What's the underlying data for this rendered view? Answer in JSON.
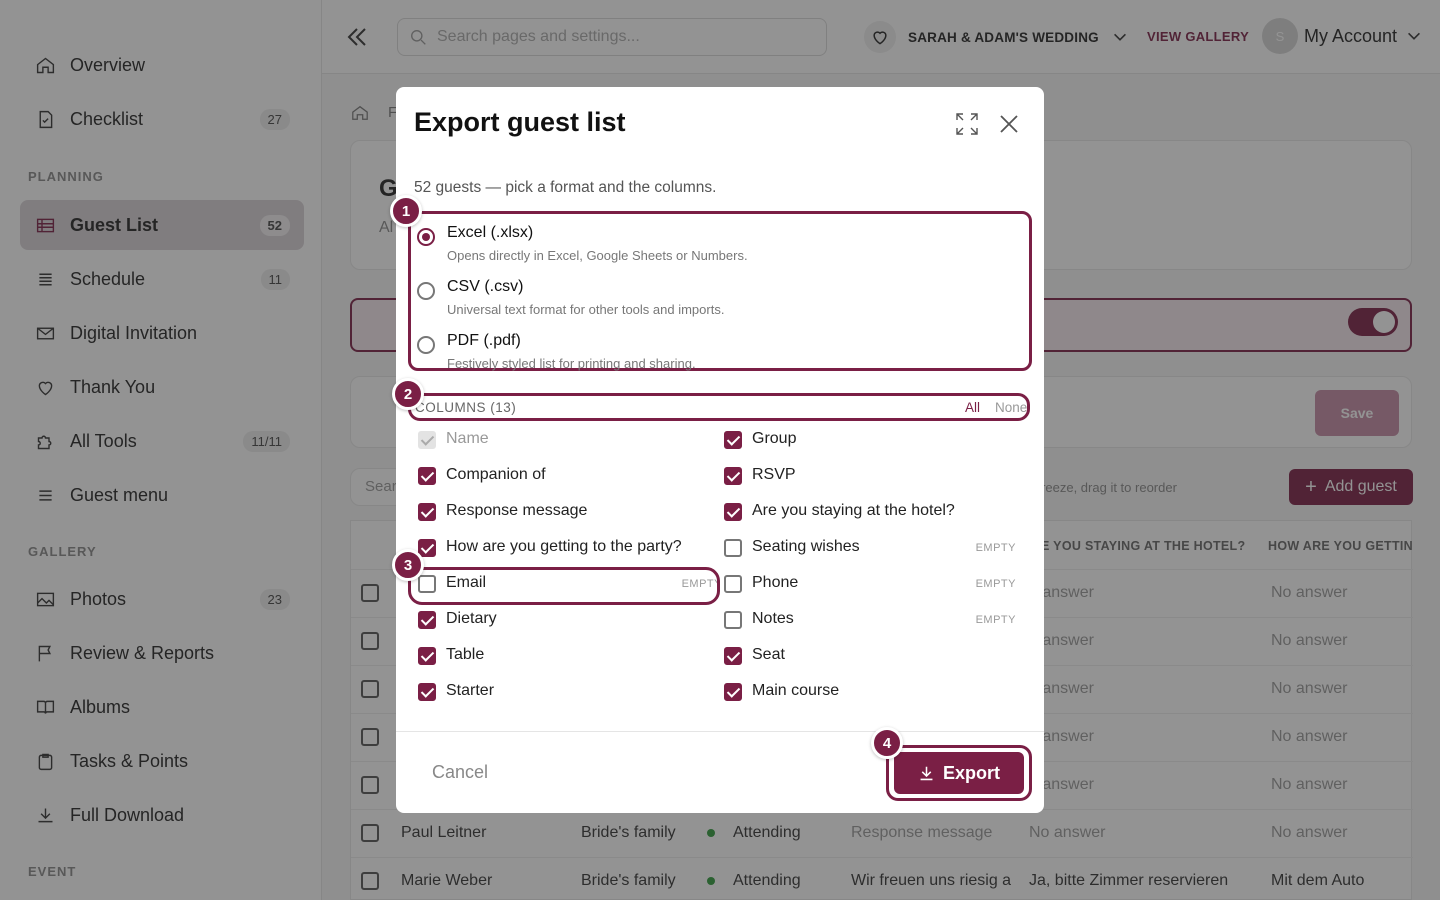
{
  "sidebar": {
    "items": [
      {
        "label": "Overview",
        "icon": "home-icon",
        "badge": ""
      },
      {
        "label": "Checklist",
        "icon": "checklist-icon",
        "badge": "27"
      },
      {
        "label": "Guest List",
        "icon": "table-icon",
        "badge": "52"
      },
      {
        "label": "Schedule",
        "icon": "list-icon",
        "badge": "11"
      },
      {
        "label": "Digital Invitation",
        "icon": "mail-icon",
        "badge": ""
      },
      {
        "label": "Thank You",
        "icon": "heart-icon",
        "badge": ""
      },
      {
        "label": "All Tools",
        "icon": "puzzle-icon",
        "badge": "11/11"
      },
      {
        "label": "Guest menu",
        "icon": "menu-icon",
        "badge": ""
      },
      {
        "label": "Photos",
        "icon": "image-icon",
        "badge": "23"
      },
      {
        "label": "Review & Reports",
        "icon": "flag-icon",
        "badge": ""
      },
      {
        "label": "Albums",
        "icon": "book-icon",
        "badge": ""
      },
      {
        "label": "Tasks & Points",
        "icon": "clipboard-icon",
        "badge": ""
      },
      {
        "label": "Full Download",
        "icon": "download-icon",
        "badge": ""
      }
    ],
    "sections": {
      "planning": "PLANNING",
      "gallery": "GALLERY",
      "event": "EVENT"
    }
  },
  "topbar": {
    "search_placeholder": "Search pages and settings...",
    "event_name": "SARAH & ADAM'S WEDDING",
    "view_gallery": "VIEW GALLERY",
    "avatar_initial": "S",
    "account_label": "My Account"
  },
  "background": {
    "add_guest": "Add guest",
    "save": "Save",
    "drag_hint": "er & freeze, drag it to reorder",
    "search_partial": "Sear",
    "title_partial": "G",
    "subtitle_partial": "Al",
    "crumb_partial": "F",
    "headers": {
      "hotel": "E YOU STAYING AT THE HOTEL?",
      "transport": "HOW ARE YOU GETTIN"
    },
    "rows": [
      {
        "name": "",
        "group": "",
        "rsvp": "",
        "message": "",
        "hotel": "o answer",
        "transport": "No answer"
      },
      {
        "name": "",
        "group": "",
        "rsvp": "",
        "message": "",
        "hotel": "o answer",
        "transport": "No answer"
      },
      {
        "name": "",
        "group": "",
        "rsvp": "",
        "message": "",
        "hotel": "o answer",
        "transport": "No answer"
      },
      {
        "name": "",
        "group": "",
        "rsvp": "",
        "message": "",
        "hotel": "o answer",
        "transport": "No answer"
      },
      {
        "name": "",
        "group": "",
        "rsvp": "",
        "message": "",
        "hotel": "o answer",
        "transport": "No answer"
      },
      {
        "name": "Paul Leitner",
        "group": "Bride's family",
        "rsvp": "Attending",
        "message": "Response message",
        "hotel": "No answer",
        "transport": "No answer"
      },
      {
        "name": "Marie Weber",
        "group": "Bride's family",
        "rsvp": "Attending",
        "message": "Wir freuen uns riesig a",
        "hotel": "Ja, bitte Zimmer reservieren",
        "transport": "Mit dem Auto"
      }
    ]
  },
  "modal": {
    "title": "Export guest list",
    "subtitle": "52 guests — pick a format and the columns.",
    "formats": [
      {
        "name": "Excel (.xlsx)",
        "desc": "Opens directly in Excel, Google Sheets or Numbers.",
        "selected": true
      },
      {
        "name": "CSV (.csv)",
        "desc": "Universal text format for other tools and imports.",
        "selected": false
      },
      {
        "name": "PDF (.pdf)",
        "desc": "Festively styled list for printing and sharing.",
        "selected": false
      }
    ],
    "columns_label": "COLUMNS (13)",
    "all_label": "All",
    "none_label": "None",
    "empty_label": "EMPTY",
    "columns": [
      {
        "label": "Name",
        "state": "disabled",
        "empty": false
      },
      {
        "label": "Group",
        "state": "on",
        "empty": false
      },
      {
        "label": "Companion of",
        "state": "on",
        "empty": false
      },
      {
        "label": "RSVP",
        "state": "on",
        "empty": false
      },
      {
        "label": "Response message",
        "state": "on",
        "empty": false
      },
      {
        "label": "Are you staying at the hotel?",
        "state": "on",
        "empty": false
      },
      {
        "label": "How are you getting to the party?",
        "state": "on",
        "empty": false
      },
      {
        "label": "Seating wishes",
        "state": "off",
        "empty": true
      },
      {
        "label": "Email",
        "state": "off",
        "empty": true
      },
      {
        "label": "Phone",
        "state": "off",
        "empty": true
      },
      {
        "label": "Dietary",
        "state": "on",
        "empty": false
      },
      {
        "label": "Notes",
        "state": "off",
        "empty": true
      },
      {
        "label": "Table",
        "state": "on",
        "empty": false
      },
      {
        "label": "Seat",
        "state": "on",
        "empty": false
      },
      {
        "label": "Starter",
        "state": "on",
        "empty": false
      },
      {
        "label": "Main course",
        "state": "on",
        "empty": false
      }
    ],
    "cancel": "Cancel",
    "export": "Export",
    "steps": [
      "1",
      "2",
      "3",
      "4"
    ]
  },
  "colors": {
    "accent": "#7a1f45",
    "attending": "#2e9b3a"
  }
}
